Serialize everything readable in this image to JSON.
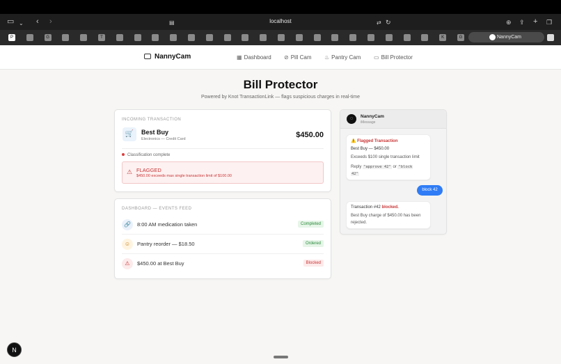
{
  "browser": {
    "url": "localhost",
    "active_tab": "NannyCam",
    "favicon_letters": [
      "P",
      "",
      "G",
      "",
      "",
      "T",
      "",
      "",
      "",
      "",
      "",
      "",
      "",
      "",
      "",
      "",
      "",
      "",
      "",
      "",
      "",
      "",
      "",
      "",
      "K",
      "G",
      "G"
    ]
  },
  "nav": {
    "brand": "NannyCam",
    "links": [
      {
        "label": "Dashboard",
        "icon": "▦"
      },
      {
        "label": "Pill Cam",
        "icon": "⊘"
      },
      {
        "label": "Pantry Cam",
        "icon": "♨"
      },
      {
        "label": "Bill Protector",
        "icon": "▭"
      }
    ]
  },
  "page": {
    "title": "Bill Protector",
    "subtitle": "Powered by Knot TransactionLink — flags suspicious charges in real-time"
  },
  "transaction": {
    "section_label": "Incoming Transaction",
    "merchant": "Best Buy",
    "category": "Electronics — Credit Card",
    "amount": "$450.00",
    "status": "Classification complete",
    "flag_title": "FLAGGED",
    "flag_detail": "$450.00 exceeds max single transaction limit of $100.00"
  },
  "feed": {
    "section_label": "Dashboard — Events Feed",
    "items": [
      {
        "icon": "🔗",
        "text": "8:00 AM medication taken",
        "badge": "Completed",
        "badge_color": "#2e8b3e",
        "badge_bg": "#e6f5e8",
        "icon_color": "#3a72c8",
        "icon_bg": "#eaf1fb"
      },
      {
        "icon": "☺",
        "text": "Pantry reorder — $18.50",
        "badge": "Ordered",
        "badge_color": "#2e8b3e",
        "badge_bg": "#e6f5e8",
        "icon_color": "#c07a10",
        "icon_bg": "#fff4e0"
      },
      {
        "icon": "⚠",
        "text": "$450.00 at Best Buy",
        "badge": "Blocked",
        "badge_color": "#c93535",
        "badge_bg": "#fdeaea",
        "icon_color": "#c93535",
        "icon_bg": "#fdeaea"
      }
    ]
  },
  "imessage": {
    "contact": "NannyCam",
    "service": "iMessage",
    "alert": {
      "title": "Flagged Transaction",
      "line1": "Best Buy — $450.00",
      "line2": "Exceeds $100 single transaction limit",
      "reply_prefix": "Reply",
      "approve_cmd": "\"approve 42\"",
      "or": "or",
      "block_cmd_a": "\"block",
      "block_cmd_b": "42\""
    },
    "my_reply": "block 42",
    "confirm": {
      "prefix": "Transaction #42",
      "status": "blocked.",
      "line1": "Best Buy charge of $450.00 has been",
      "line2": "rejected."
    }
  },
  "dev_badge": "N"
}
